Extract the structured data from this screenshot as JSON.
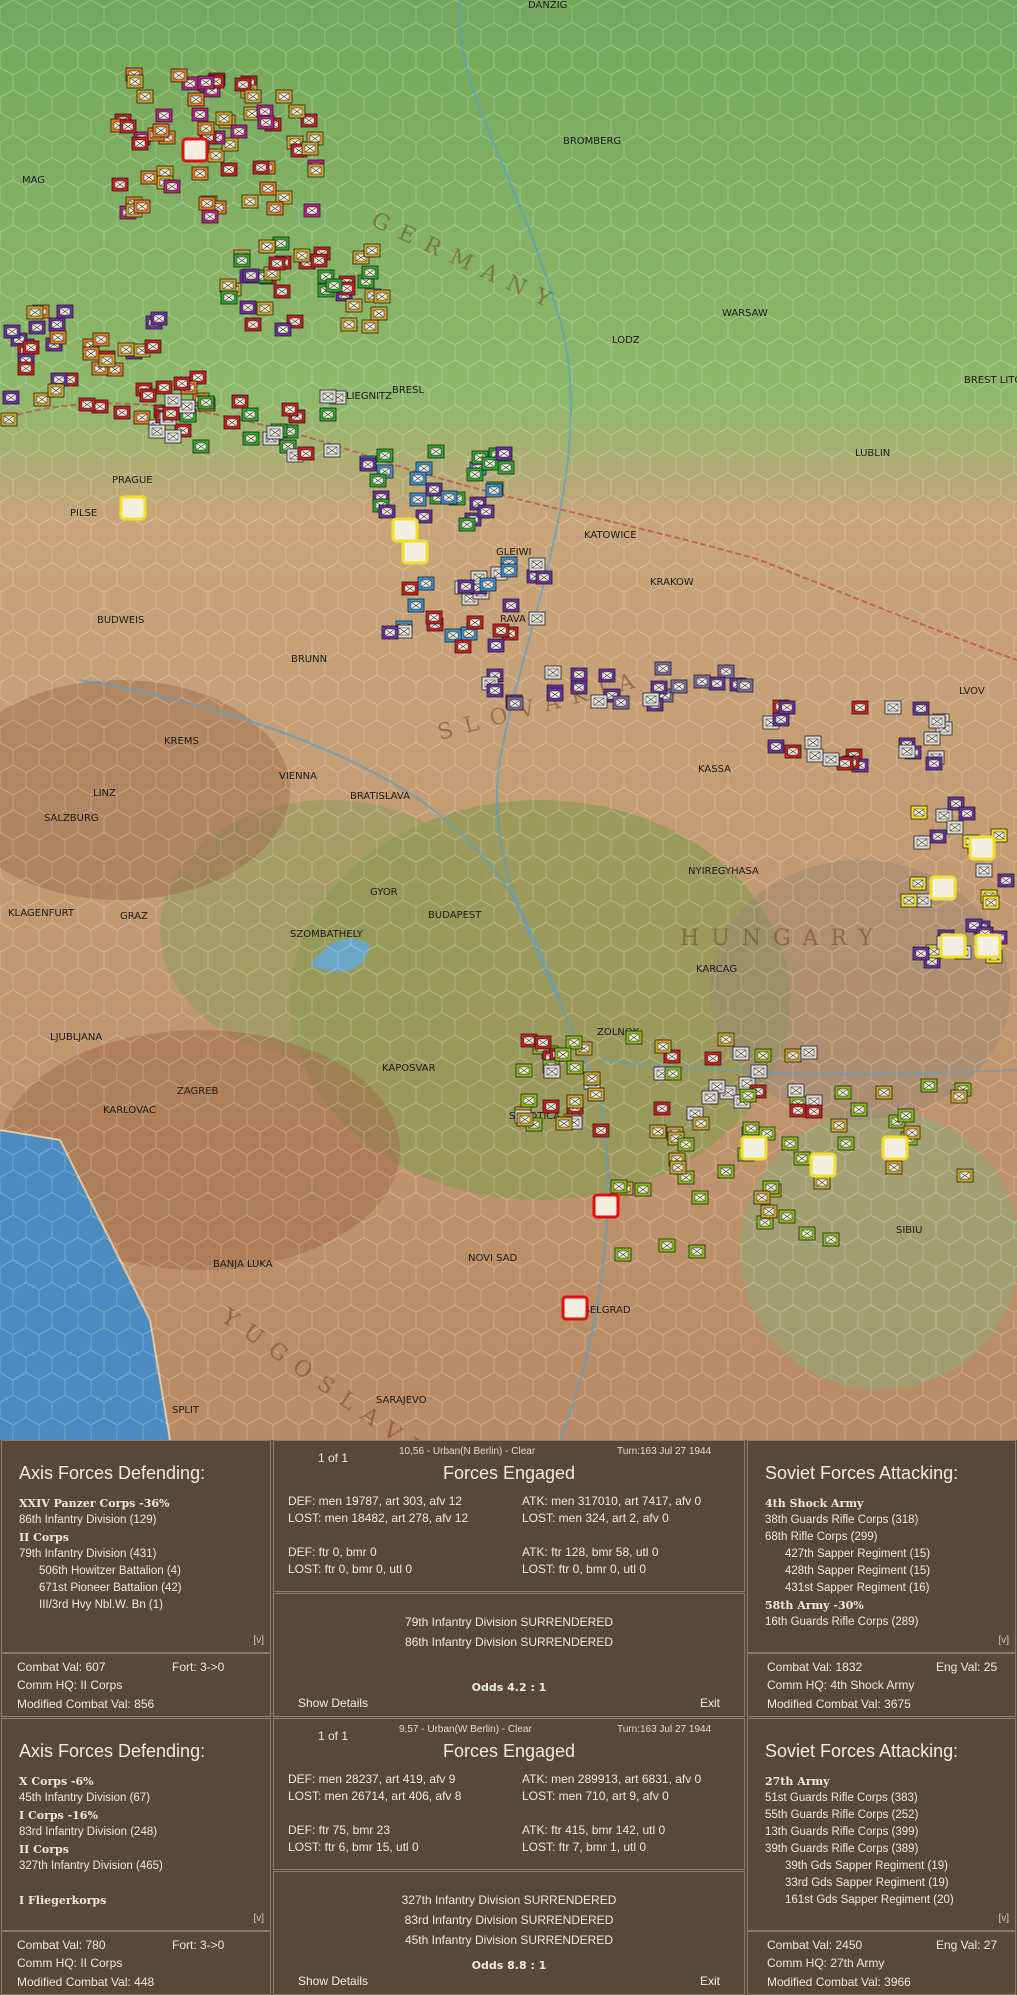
{
  "map": {
    "cities": [
      "DANZIG",
      "BROMBERG",
      "MAG",
      "LIEGNITZ",
      "WARSAW",
      "LODZ",
      "BREST LITOV",
      "BRESL",
      "LUBLIN",
      "PRAGUE",
      "KATOWICE",
      "GLEIWI",
      "KRAKOW",
      "PILSE",
      "BUDWEIS",
      "BRUNN",
      "RAVA",
      "LVOV",
      "KREMS",
      "LINZ",
      "VIENNA",
      "BRATISLAVA",
      "KASSA",
      "SALZBURG",
      "GYOR",
      "BUDAPEST",
      "NYIREGYHASA",
      "KLAGENFURT",
      "GRAZ",
      "SZOMBATHELY",
      "KARCAG",
      "LJUBLJANA",
      "ZOLNOK",
      "KAPOSVAR",
      "ZAGREB",
      "KARLOVAC",
      "SUBOTICA",
      "NOVI SAD",
      "SIBIU",
      "BANJA LUKA",
      "BELGRAD",
      "SARAJEVO",
      "SPLIT",
      "GERMANY",
      "SLOVAKIA",
      "HUNGARY",
      "YUGOSLAVIA"
    ],
    "colors": {
      "soviet": "#6a2f9e",
      "german": "#c81d1d",
      "highlight": "#f0e02a",
      "selected": "#e01010",
      "grass": "#7fb267",
      "mountain": "#9b6b4d"
    }
  },
  "reports": [
    {
      "defender_title": "Axis Forces Defending:",
      "defenders": [
        {
          "name": "XXIV Panzer Corps  -36%",
          "style": "bold"
        },
        {
          "name": "86th Infantry Division (129)",
          "style": "normal"
        },
        {
          "name": "II Corps",
          "style": "bold"
        },
        {
          "name": "79th Infantry Division (431)",
          "style": "normal"
        },
        {
          "name": "506th Howitzer Battalion (4)",
          "style": "indent"
        },
        {
          "name": "671st Pioneer Battalion (42)",
          "style": "indent"
        },
        {
          "name": "III/3rd Hvy Nbl.W. Bn (1)",
          "style": "indent"
        }
      ],
      "defender_v": "[v]",
      "def_combat_val": "Combat Val: 607",
      "def_fort": "Fort: 3->0",
      "def_comm_hq": "Comm HQ: II Corps",
      "def_mod_val": "Modified Combat Val: 856",
      "page_of": "1 of 1",
      "location": "10,56 - Urban(N Berlin) - Clear",
      "turn": "Turn:163  Jul 27 1944",
      "forces_title": "Forces Engaged",
      "def_lines": [
        "DEF: men 19787, art 303, afv 12",
        "LOST: men 18482, art 278, afv 12",
        "",
        "DEF: ftr 0, bmr 0",
        "LOST: ftr 0, bmr 0, utl 0"
      ],
      "atk_lines": [
        "ATK: men 317010, art 7417, afv 0",
        "LOST: men 324, art 2, afv 0",
        "",
        "ATK: ftr 128, bmr 58, utl 0",
        "LOST: ftr 0, bmr 0, utl 0"
      ],
      "messages": [
        "79th Infantry Division SURRENDERED",
        "86th Infantry Division SURRENDERED"
      ],
      "show_details": "Show Details",
      "odds": "Odds 4.2 : 1",
      "exit": "Exit",
      "attacker_title": "Soviet Forces Attacking:",
      "attackers": [
        {
          "name": "4th Shock Army",
          "style": "bold"
        },
        {
          "name": "38th Guards Rifle Corps (318)",
          "style": "normal"
        },
        {
          "name": "68th Rifle Corps (299)",
          "style": "normal"
        },
        {
          "name": "427th Sapper Regiment (15)",
          "style": "indent"
        },
        {
          "name": "428th Sapper Regiment (15)",
          "style": "indent"
        },
        {
          "name": "431st Sapper Regiment (16)",
          "style": "indent"
        },
        {
          "name": "58th Army  -30%",
          "style": "bold"
        },
        {
          "name": "16th Guards Rifle Corps (289)",
          "style": "normal"
        }
      ],
      "attacker_v": "[v]",
      "atk_combat_val": "Combat Val: 1832",
      "atk_eng_val": "Eng Val: 25",
      "atk_comm_hq": "Comm HQ: 4th Shock Army",
      "atk_mod_val": "Modified Combat Val: 3675"
    },
    {
      "defender_title": "Axis Forces Defending:",
      "defenders": [
        {
          "name": "X Corps  -6%",
          "style": "bold"
        },
        {
          "name": "45th Infantry Division (67)",
          "style": "normal"
        },
        {
          "name": "I Corps  -16%",
          "style": "bold"
        },
        {
          "name": "83rd Infantry Division (248)",
          "style": "normal"
        },
        {
          "name": "II Corps",
          "style": "bold"
        },
        {
          "name": "327th Infantry Division (465)",
          "style": "normal"
        },
        {
          "name": "",
          "style": "gap"
        },
        {
          "name": "I Fliegerkorps",
          "style": "bold"
        }
      ],
      "defender_v": "[v]",
      "def_combat_val": "Combat Val: 780",
      "def_fort": "Fort: 3->0",
      "def_comm_hq": "Comm HQ: II Corps",
      "def_mod_val": "Modified Combat Val: 448",
      "page_of": "1 of 1",
      "location": "9,57 - Urban(W Berlin) - Clear",
      "turn": "Turn:163  Jul 27 1944",
      "forces_title": "Forces Engaged",
      "def_lines": [
        "DEF: men 28237, art 419, afv 9",
        "LOST: men 26714, art 406, afv 8",
        "",
        "DEF: ftr 75, bmr 23",
        "LOST: ftr 6, bmr 15, utl 0"
      ],
      "atk_lines": [
        "ATK: men 289913, art 6831, afv 0",
        "LOST: men 710, art 9, afv 0",
        "",
        "ATK: ftr 415, bmr 142, utl 0",
        "LOST: ftr 7, bmr 1, utl 0"
      ],
      "messages": [
        "327th Infantry Division SURRENDERED",
        "83rd Infantry Division SURRENDERED",
        "45th Infantry Division SURRENDERED"
      ],
      "show_details": "Show Details",
      "odds": "Odds 8.8 : 1",
      "exit": "Exit",
      "attacker_title": "Soviet Forces Attacking:",
      "attackers": [
        {
          "name": "27th Army",
          "style": "bold"
        },
        {
          "name": "51st Guards Rifle Corps (383)",
          "style": "normal"
        },
        {
          "name": "55th Guards Rifle Corps (252)",
          "style": "normal"
        },
        {
          "name": "13th Guards Rifle Corps (399)",
          "style": "normal"
        },
        {
          "name": "39th Guards Rifle Corps (389)",
          "style": "normal"
        },
        {
          "name": "39th Gds Sapper Regiment (19)",
          "style": "indent"
        },
        {
          "name": "33rd Gds Sapper Regiment (19)",
          "style": "indent"
        },
        {
          "name": "161st Gds Sapper Regiment (20)",
          "style": "indent"
        }
      ],
      "attacker_v": "[v]",
      "atk_combat_val": "Combat Val: 2450",
      "atk_eng_val": "Eng Val: 27",
      "atk_comm_hq": "Comm HQ: 27th Army",
      "atk_mod_val": "Modified Combat Val: 3966"
    }
  ]
}
